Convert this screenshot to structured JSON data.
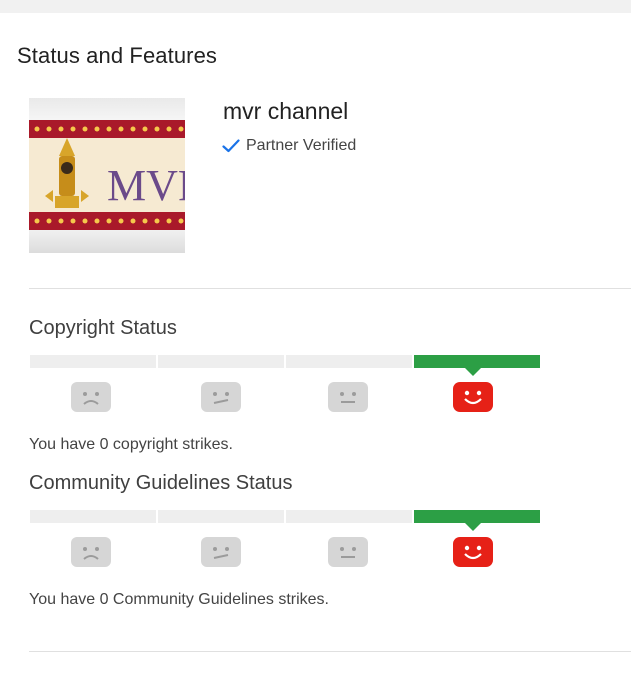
{
  "page": {
    "title": "Status and Features"
  },
  "channel": {
    "name": "mvr channel",
    "verified_label": "Partner Verified",
    "logo_text": "MVR"
  },
  "copyright": {
    "title": "Copyright Status",
    "strikes": 0,
    "current_level": 4,
    "message": "You have 0 copyright strikes."
  },
  "community": {
    "title": "Community Guidelines Status",
    "strikes": 0,
    "current_level": 4,
    "message": "You have 0 Community Guidelines strikes."
  },
  "colors": {
    "active_bar": "#2c9f45",
    "inactive_bar": "#eeeeee",
    "active_face": "#e62117",
    "inactive_face": "#d6d6d6"
  },
  "icons": [
    "sad-face-icon",
    "unsure-face-icon",
    "neutral-face-icon",
    "happy-face-icon",
    "checkmark-icon"
  ]
}
